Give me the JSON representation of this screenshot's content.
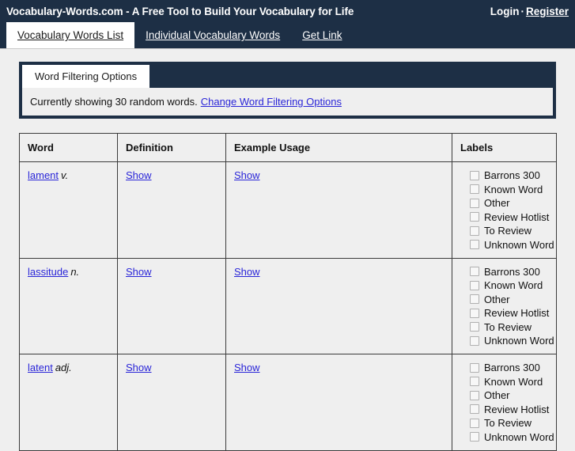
{
  "header": {
    "site_title": "Vocabulary-Words.com - A Free Tool to Build Your Vocabulary for Life",
    "login_label": "Login",
    "separator": "·",
    "register_label": "Register"
  },
  "nav": {
    "tabs": [
      {
        "label": "Vocabulary Words List",
        "active": true
      },
      {
        "label": "Individual Vocabulary Words",
        "active": false
      },
      {
        "label": "Get Link",
        "active": false
      }
    ]
  },
  "filter_panel": {
    "tab_label": "Word Filtering Options",
    "status_text": "Currently showing 30 random words.",
    "change_link_label": "Change Word Filtering Options"
  },
  "table": {
    "columns": [
      "Word",
      "Definition",
      "Example Usage",
      "Labels"
    ],
    "show_label": "Show",
    "label_options": [
      "Barrons 300",
      "Known Word",
      "Other",
      "Review Hotlist",
      "To Review",
      "Unknown Word"
    ],
    "rows": [
      {
        "word": "lament",
        "pos": "v.",
        "definition": "Show",
        "example": "Show"
      },
      {
        "word": "lassitude",
        "pos": "n.",
        "definition": "Show",
        "example": "Show"
      },
      {
        "word": "latent",
        "pos": "adj.",
        "definition": "Show",
        "example": "Show"
      }
    ]
  },
  "colors": {
    "navy": "#1d2f45",
    "link_blue": "#2a25d8",
    "page_bg": "#efefef"
  }
}
